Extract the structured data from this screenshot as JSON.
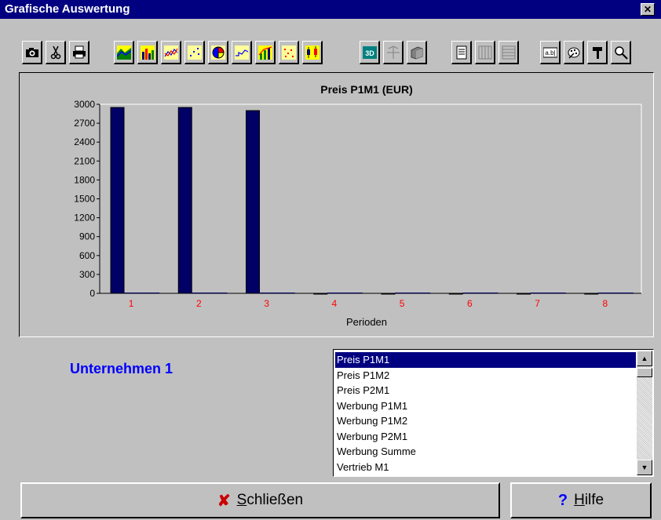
{
  "window": {
    "title": "Grafische Auswertung",
    "close_symbol": "✕"
  },
  "toolbar": {
    "groups": [
      [
        "camera-icon",
        "scissors-icon",
        "printer-icon"
      ],
      [
        "area-chart-icon",
        "bar-chart-icon",
        "line-chart-icon",
        "scatter-chart-icon",
        "pie-chart-icon",
        "step-chart-icon",
        "combo-chart-icon",
        "dot-chart-icon",
        "candlestick-chart-icon"
      ],
      [
        "3d-icon",
        "rotate-icon",
        "pages-icon"
      ],
      [
        "page-icon",
        "vertical-grid-icon",
        "horizontal-grid-icon"
      ],
      [
        "text-label-icon",
        "palette-icon",
        "hammer-icon",
        "zoom-icon"
      ]
    ],
    "label_3d": "3D",
    "label_text": "a.b|"
  },
  "chart_data": {
    "type": "bar",
    "title": "Preis P1M1 (EUR)",
    "xlabel": "Perioden",
    "ylabel": "",
    "categories": [
      "1",
      "2",
      "3",
      "4",
      "5",
      "6",
      "7",
      "8"
    ],
    "series": [
      {
        "values": [
          2950,
          2950,
          2900,
          0,
          0,
          0,
          0,
          0
        ],
        "color": "#000066"
      },
      {
        "values": [
          0,
          0,
          0,
          0,
          0,
          0,
          0,
          0
        ],
        "color": "#000066"
      }
    ],
    "ylim": [
      0,
      3000
    ],
    "yticks": [
      0,
      300,
      600,
      900,
      1200,
      1500,
      1800,
      2100,
      2400,
      2700,
      3000
    ],
    "category_label_color": "#ff0000",
    "grid": false,
    "legend": "none"
  },
  "company": {
    "label": "Unternehmen 1",
    "color": "#0000ff"
  },
  "listbox": {
    "items": [
      "Preis P1M1",
      "Preis P1M2",
      "Preis P2M1",
      "Werbung P1M1",
      "Werbung P1M2",
      "Werbung P2M1",
      "Werbung Summe",
      "Vertrieb M1"
    ],
    "selected_index": 0
  },
  "buttons": {
    "close": {
      "label_mnemonic": "S",
      "label_rest": "chließen",
      "icon": "✘"
    },
    "help": {
      "label_mnemonic": "H",
      "label_rest": "ilfe",
      "icon": "?"
    }
  }
}
